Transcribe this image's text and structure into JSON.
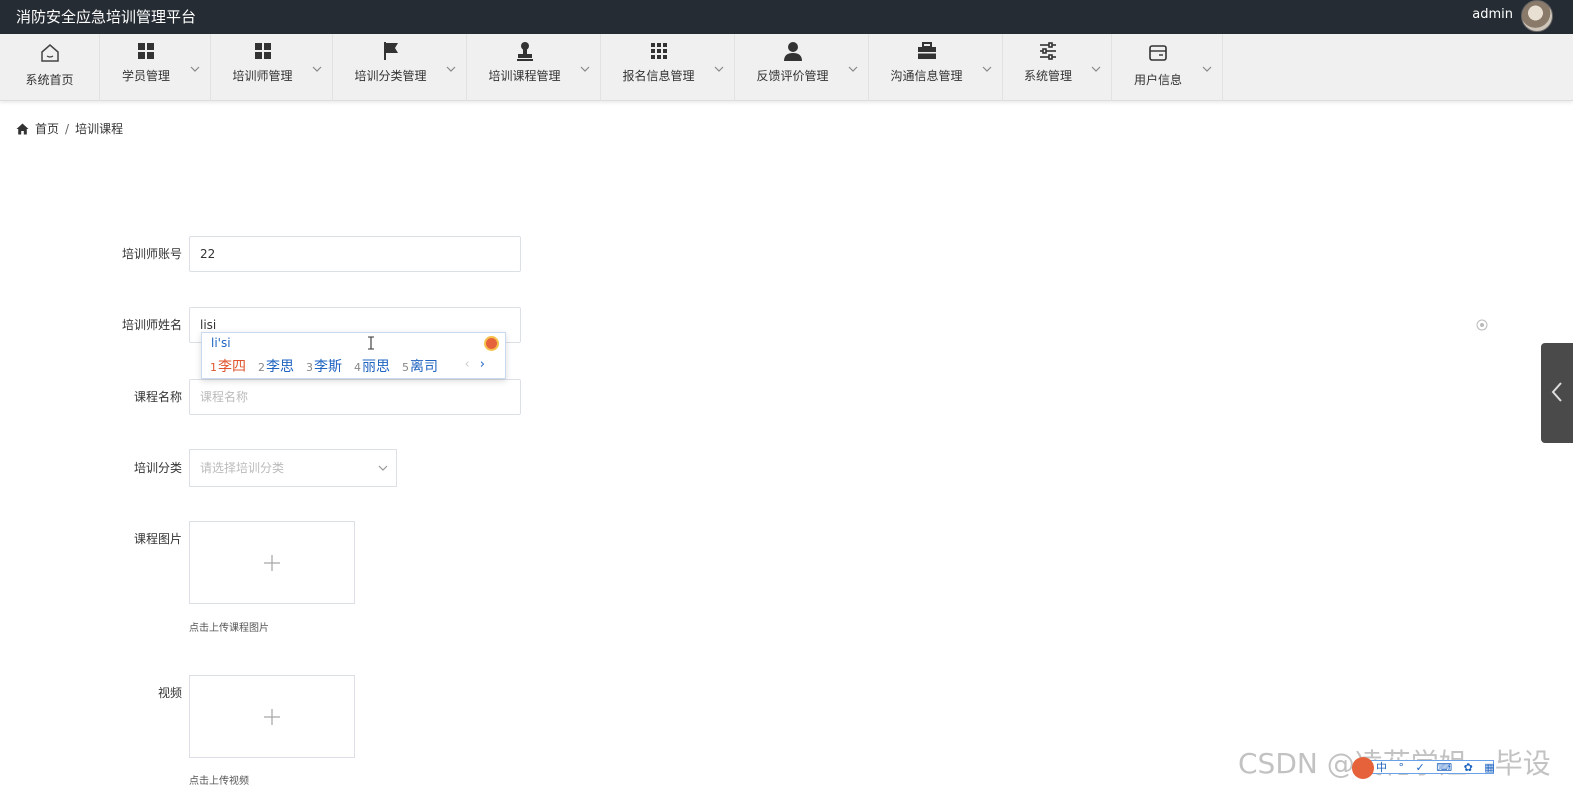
{
  "header": {
    "app_title": "消防安全应急培训管理平台",
    "user_name": "admin"
  },
  "nav": [
    {
      "label": "系统首页",
      "icon": "home-icon"
    },
    {
      "label": "学员管理",
      "icon": "grid-icon"
    },
    {
      "label": "培训师管理",
      "icon": "grid-icon"
    },
    {
      "label": "培训分类管理",
      "icon": "flag-icon"
    },
    {
      "label": "培训课程管理",
      "icon": "stamp-icon"
    },
    {
      "label": "报名信息管理",
      "icon": "apps-icon"
    },
    {
      "label": "反馈评价管理",
      "icon": "user-icon"
    },
    {
      "label": "沟通信息管理",
      "icon": "briefcase-icon"
    },
    {
      "label": "系统管理",
      "icon": "sliders-icon"
    },
    {
      "label": "用户信息",
      "icon": "card-icon"
    }
  ],
  "breadcrumb": {
    "home": "首页",
    "separator": "/",
    "current": "培训课程"
  },
  "form": {
    "trainer_account": {
      "label": "培训师账号",
      "value": "22"
    },
    "trainer_name": {
      "label": "培训师姓名",
      "value": "lisi"
    },
    "course_name": {
      "label": "课程名称",
      "placeholder": "课程名称"
    },
    "category": {
      "label": "培训分类",
      "placeholder": "请选择培训分类"
    },
    "course_image": {
      "label": "课程图片",
      "hint": "点击上传课程图片"
    },
    "video": {
      "label": "视频",
      "hint": "点击上传视频"
    }
  },
  "ime": {
    "pinyin": "li'si",
    "candidates": [
      {
        "num": "1",
        "text": "李四"
      },
      {
        "num": "2",
        "text": "李思"
      },
      {
        "num": "3",
        "text": "李斯"
      },
      {
        "num": "4",
        "text": "丽思"
      },
      {
        "num": "5",
        "text": "离司"
      }
    ],
    "prev": "‹",
    "next": "›",
    "toolbar_text": "中 ° ✓ ⌨ ✿ ▦"
  },
  "watermark": "CSDN @凌花学姐一毕设"
}
